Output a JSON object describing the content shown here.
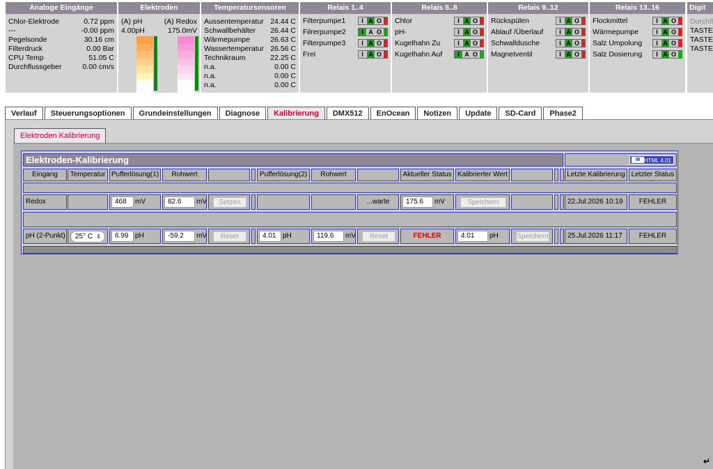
{
  "analog": {
    "title": "Analoge Eingänge",
    "rows": [
      {
        "label": "Chlor-Elektrode",
        "value": "0.72 ppm"
      },
      {
        "label": "---",
        "value": "-0.00 ppm"
      },
      {
        "label": "Pegelsonde",
        "value": "30.16 cm"
      },
      {
        "label": "Filterdruck",
        "value": "0.00 Bar"
      },
      {
        "label": "CPU Temp",
        "value": "51.05 C"
      },
      {
        "label": "Durchflussgeber",
        "value": "0.00 cm/s"
      }
    ]
  },
  "electrodes": {
    "title": "Elektroden",
    "ph_label": "(A) pH",
    "redox_label": "(A) Redox",
    "ph_value": "4.00pH",
    "redox_value": "175.0mV",
    "ph_colors": [
      "#f7a04a",
      "#f9ae5e",
      "#fabf74",
      "#fbd08a",
      "#fce3a0",
      "#fdf6b6"
    ],
    "redox_colors": [
      "#f78ad2",
      "#f89ad8",
      "#f9addf",
      "#fac0e6",
      "#fbd3ed",
      "#fde7f4"
    ]
  },
  "temps": {
    "title": "Temperatursensoren",
    "rows": [
      {
        "label": "Aussentemperatur",
        "value": "24.44 C"
      },
      {
        "label": "Schwallbehälter",
        "value": "26.44 C"
      },
      {
        "label": "Wärmepumpe",
        "value": "26.63 C"
      },
      {
        "label": "Wassertemperatur",
        "value": "26.56 C"
      },
      {
        "label": "Technikraum",
        "value": "22.25 C"
      },
      {
        "label": "n.a.",
        "value": "0.00 C"
      },
      {
        "label": "n.a.",
        "value": "0.00 C"
      },
      {
        "label": "n.a.",
        "value": "0.00 C"
      }
    ]
  },
  "relay1": {
    "title": "Relais 1..4",
    "items": [
      {
        "label": "Filterpumpe1",
        "state": "A",
        "led": "r"
      },
      {
        "label": "Filrerpumpe2",
        "state": "I",
        "led": "g"
      },
      {
        "label": "Filterpumpe3",
        "state": "A",
        "led": "r"
      },
      {
        "label": "Frei",
        "state": "A",
        "led": "r"
      }
    ]
  },
  "relay2": {
    "title": "Relais 5..8",
    "items": [
      {
        "label": "Chlor",
        "state": "A",
        "led": "r"
      },
      {
        "label": "pH-",
        "state": "A",
        "led": "r"
      },
      {
        "label": "Kugelhahn Zu",
        "state": "A",
        "led": "r"
      },
      {
        "label": "Kugelhahn Auf",
        "state": "I",
        "led": "g"
      }
    ]
  },
  "relay3": {
    "title": "Relais 9..12",
    "items": [
      {
        "label": "Rückspülen",
        "state": "A",
        "led": "r"
      },
      {
        "label": "Ablauf /Überlauf",
        "state": "A",
        "led": "r"
      },
      {
        "label": "Schwalldusche",
        "state": "A",
        "led": "r"
      },
      {
        "label": "Magnetventil",
        "state": "A",
        "led": "r"
      }
    ]
  },
  "relay4": {
    "title": "Relais 13..16",
    "items": [
      {
        "label": "Flockmittel",
        "state": "A",
        "led": "r"
      },
      {
        "label": "Wärmepumpe",
        "state": "A",
        "led": "r"
      },
      {
        "label": "Salz Umpolung",
        "state": "A",
        "led": "r"
      },
      {
        "label": "Salz Dosierung",
        "state": "A",
        "led": "g"
      }
    ]
  },
  "digital": {
    "title": "Digit",
    "rows": [
      "Durchfl",
      "TASTER",
      "TASTER",
      "TASTER"
    ]
  },
  "iao_letters": [
    "I",
    "A",
    "O"
  ],
  "tabs": [
    "Verlauf",
    "Steuerungsoptionen",
    "Grundeinstellungen",
    "Diagnose",
    "Kalibrierung",
    "DMX512",
    "EnOcean",
    "Notizen",
    "Update",
    "SD-Card",
    "Phase2"
  ],
  "subtab": "Elektroden Kalibrierung",
  "calib": {
    "title": "Elektroden-Kalibrierung",
    "badge": "HTML 4.01",
    "headers": [
      "Eingang",
      "Temperatur",
      "Pufferlösung(1)",
      "Rohwert",
      "",
      "Pufferlösung(2)",
      "Rohwert",
      "",
      "Aktueller Status",
      "Kalibrierter Wert",
      "",
      "Letzte Kalibrierung",
      "Letzter Status"
    ],
    "redox": {
      "label": "Redox",
      "buf1": "468",
      "buf1_unit": "mV",
      "raw1": "82.6",
      "raw1_unit": "mV",
      "set_btn": "Setzen",
      "status": "...warte",
      "cal_value": "175.6",
      "cal_unit": "mV",
      "save_btn": "Speichern",
      "last_cal": "22.Jul.2026 10:19",
      "last_status": "FEHLER"
    },
    "ph": {
      "label": "pH (2-Punkt)",
      "temp": "25° C",
      "buf1": "6.99",
      "buf1_unit": "pH",
      "raw1": "-59.2",
      "raw1_unit": "mV",
      "reset1": "Reset",
      "buf2": "4.01",
      "buf2_unit": "pH",
      "raw2": "119.6",
      "raw2_unit": "mV",
      "reset2": "Reset",
      "status": "FEHLER",
      "cal_value": "4.01",
      "cal_unit": "pH",
      "save_btn": "Speichern",
      "last_cal": "25.Jul.2026 11:17",
      "last_status": "FEHLER"
    }
  }
}
